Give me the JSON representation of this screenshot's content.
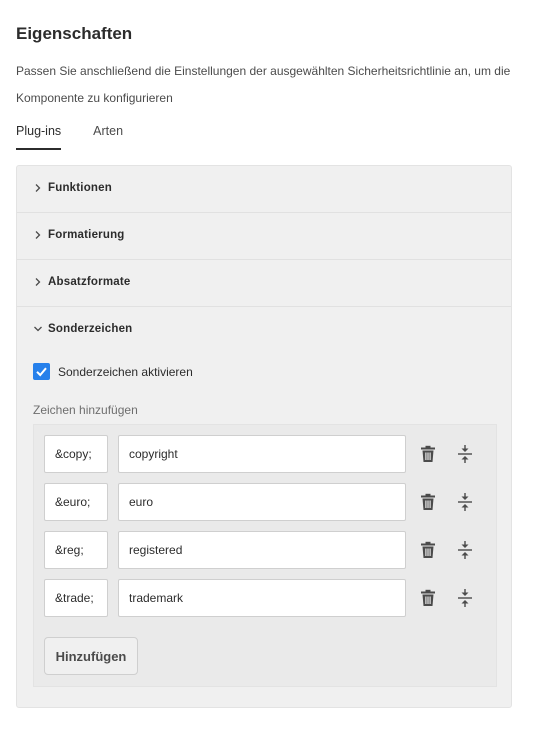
{
  "header": {
    "title": "Eigenschaften",
    "description": "Passen Sie anschließend die Einstellungen der ausgewählten Sicherheitsrichtlinie an, um die Komponente zu konfigurieren"
  },
  "tabs": [
    {
      "label": "Plug-ins",
      "active": true
    },
    {
      "label": "Arten",
      "active": false
    }
  ],
  "accordion": {
    "collapsed": [
      {
        "label": "Funktionen"
      },
      {
        "label": "Formatierung"
      },
      {
        "label": "Absatzformate"
      }
    ],
    "expanded": {
      "label": "Sonderzeichen",
      "checkbox_label": "Sonderzeichen aktivieren",
      "checkbox_checked": true,
      "field_label": "Zeichen hinzufügen",
      "rows": [
        {
          "code": "&copy;",
          "name": "copyright"
        },
        {
          "code": "&euro;",
          "name": "euro"
        },
        {
          "code": "&reg;",
          "name": "registered"
        },
        {
          "code": "&trade;",
          "name": "trademark"
        }
      ],
      "add_label": "Hinzufügen"
    }
  },
  "colors": {
    "accent": "#2680eb",
    "panel_bg": "#f0f0f0"
  }
}
